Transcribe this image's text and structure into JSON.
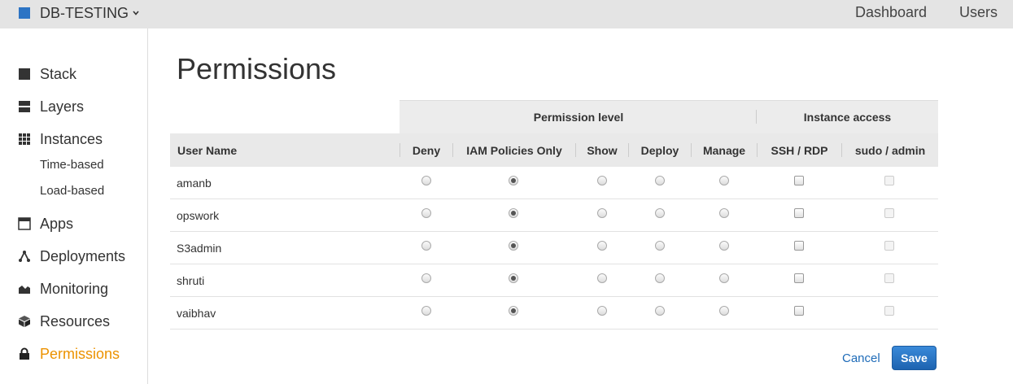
{
  "topbar": {
    "stack_name": "DB-TESTING",
    "nav": [
      "Dashboard",
      "Users"
    ],
    "accent_color": "#2d74c4"
  },
  "sidebar": {
    "items": [
      {
        "label": "Stack",
        "icon": "stack-square-icon"
      },
      {
        "label": "Layers",
        "icon": "layers-icon"
      },
      {
        "label": "Instances",
        "icon": "instances-grid-icon"
      },
      {
        "label": "Apps",
        "icon": "apps-icon"
      },
      {
        "label": "Deployments",
        "icon": "deployments-icon"
      },
      {
        "label": "Monitoring",
        "icon": "monitoring-icon"
      },
      {
        "label": "Resources",
        "icon": "resources-cube-icon"
      },
      {
        "label": "Permissions",
        "icon": "lock-icon",
        "active": true
      }
    ],
    "sub_items": [
      "Time-based",
      "Load-based"
    ],
    "active_color": "#ec9200"
  },
  "page": {
    "title": "Permissions"
  },
  "table": {
    "groups": [
      "Permission level",
      "Instance access"
    ],
    "columns": [
      "User Name",
      "Deny",
      "IAM Policies Only",
      "Show",
      "Deploy",
      "Manage",
      "SSH / RDP",
      "sudo / admin"
    ],
    "rows": [
      {
        "user": "amanb",
        "level": "IAM Policies Only",
        "ssh": false,
        "sudo": false
      },
      {
        "user": "opswork",
        "level": "IAM Policies Only",
        "ssh": false,
        "sudo": false
      },
      {
        "user": "S3admin",
        "level": "IAM Policies Only",
        "ssh": false,
        "sudo": false
      },
      {
        "user": "shruti",
        "level": "IAM Policies Only",
        "ssh": false,
        "sudo": false
      },
      {
        "user": "vaibhav",
        "level": "IAM Policies Only",
        "ssh": false,
        "sudo": false
      }
    ]
  },
  "actions": {
    "cancel": "Cancel",
    "save": "Save"
  }
}
